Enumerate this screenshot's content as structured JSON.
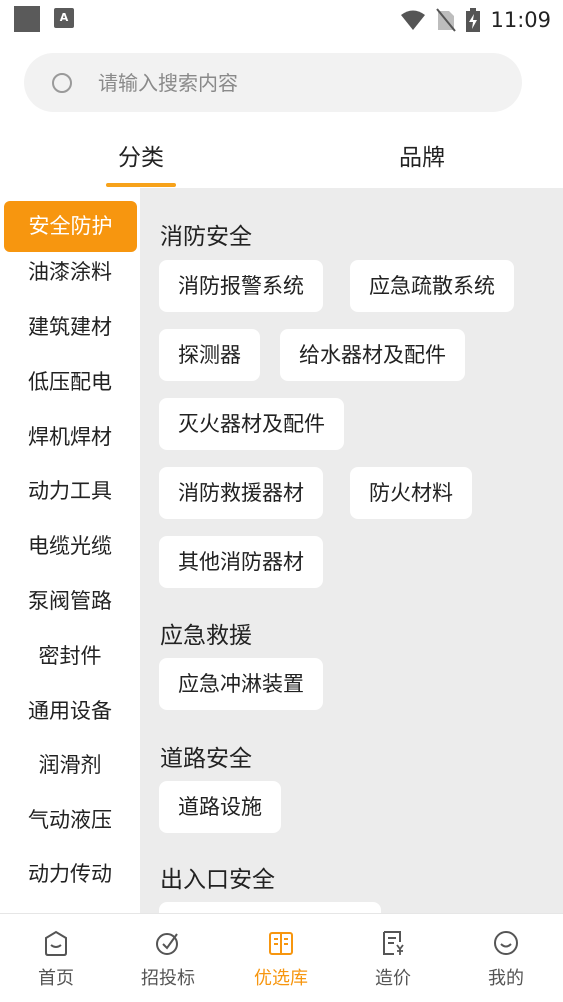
{
  "status_bar": {
    "time": "11:09",
    "notification_icon": "A"
  },
  "search": {
    "placeholder": "请输入搜索内容"
  },
  "tabs": [
    {
      "label": "分类",
      "active": true
    },
    {
      "label": "品牌",
      "active": false
    }
  ],
  "sidebar": {
    "items": [
      {
        "label": "安全防护",
        "active": true
      },
      {
        "label": "油漆涂料"
      },
      {
        "label": "建筑建材"
      },
      {
        "label": "低压配电"
      },
      {
        "label": "焊机焊材"
      },
      {
        "label": "动力工具"
      },
      {
        "label": "电缆光缆"
      },
      {
        "label": "泵阀管路"
      },
      {
        "label": "密封件"
      },
      {
        "label": "通用设备"
      },
      {
        "label": "润滑剂"
      },
      {
        "label": "气动液压"
      },
      {
        "label": "动力传动"
      }
    ]
  },
  "sections": [
    {
      "title": "消防安全",
      "chips": [
        "消防报警系统",
        "应急疏散系统",
        "探测器",
        "给水器材及配件",
        "灭火器材及配件",
        "消防救援器材",
        "防火材料",
        "其他消防器材"
      ]
    },
    {
      "title": "应急救援",
      "chips": [
        "应急冲淋装置"
      ]
    },
    {
      "title": "道路安全",
      "chips": [
        "道路设施"
      ]
    },
    {
      "title": "出入口安全",
      "chips": [
        ""
      ]
    }
  ],
  "bottom_nav": [
    {
      "label": "首页",
      "icon": "home-icon"
    },
    {
      "label": "招投标",
      "icon": "bidding-icon"
    },
    {
      "label": "优选库",
      "icon": "book-icon",
      "active": true
    },
    {
      "label": "造价",
      "icon": "price-doc-icon"
    },
    {
      "label": "我的",
      "icon": "smile-icon"
    }
  ],
  "colors": {
    "accent": "#f7960f",
    "panel_bg": "#ececec"
  }
}
